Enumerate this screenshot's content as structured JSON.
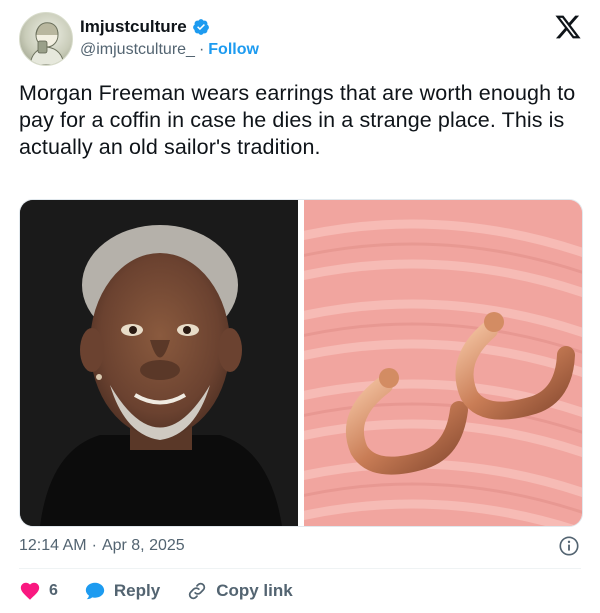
{
  "author": {
    "display_name": "Imjustculture",
    "handle": "@imjustculture_",
    "separator": "·",
    "follow_label": "Follow"
  },
  "tweet": {
    "text": "Morgan Freeman wears earrings that are worth enough to pay for a coffin in case he dies in a strange place. This is actually an old sailor's tradition."
  },
  "meta": {
    "time": "12:14 AM",
    "separator": "·",
    "date": "Apr 8, 2025"
  },
  "actions": {
    "like_count": "6",
    "reply_label": "Reply",
    "copy_link_label": "Copy link"
  },
  "icons": {
    "verified": "verified-badge-icon",
    "x_logo": "x-logo-icon",
    "info": "info-icon",
    "like": "heart-icon",
    "reply": "reply-bubble-icon",
    "link": "link-icon"
  },
  "colors": {
    "accent": "#1d9bf0",
    "like": "#f91880",
    "text": "#0f1419",
    "muted": "#536471"
  }
}
